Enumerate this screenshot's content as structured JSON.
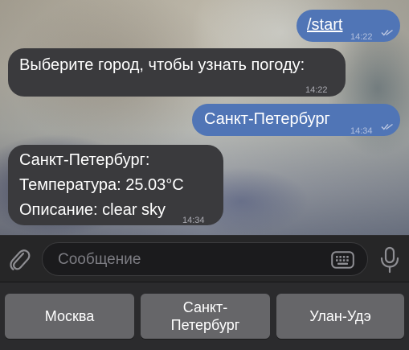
{
  "messages": [
    {
      "direction": "out",
      "text": "/start",
      "time": "14:22",
      "read": true,
      "is_command": true
    },
    {
      "direction": "in",
      "text": "Выберите город, чтобы узнать погоду:",
      "time": "14:22"
    },
    {
      "direction": "out",
      "text": "Санкт-Петербург",
      "time": "14:34",
      "read": true
    },
    {
      "direction": "in",
      "lines": [
        "Санкт-Петербург:",
        "Температура: 25.03°C",
        "Описание: clear sky"
      ],
      "time": "14:34"
    }
  ],
  "composer": {
    "placeholder": "Сообщение",
    "attach_icon": "paperclip-icon",
    "keyboard_icon": "keyboard-icon",
    "mic_icon": "microphone-icon"
  },
  "reply_keyboard": {
    "buttons": [
      {
        "lines": [
          "Москва"
        ]
      },
      {
        "lines": [
          "Санкт-",
          "Петербург"
        ]
      },
      {
        "lines": [
          "Улан-Удэ"
        ]
      }
    ]
  },
  "colors": {
    "outgoing_bubble": "#5075b6",
    "incoming_bubble": "#3a3a3d",
    "keyboard_button": "#666669"
  }
}
